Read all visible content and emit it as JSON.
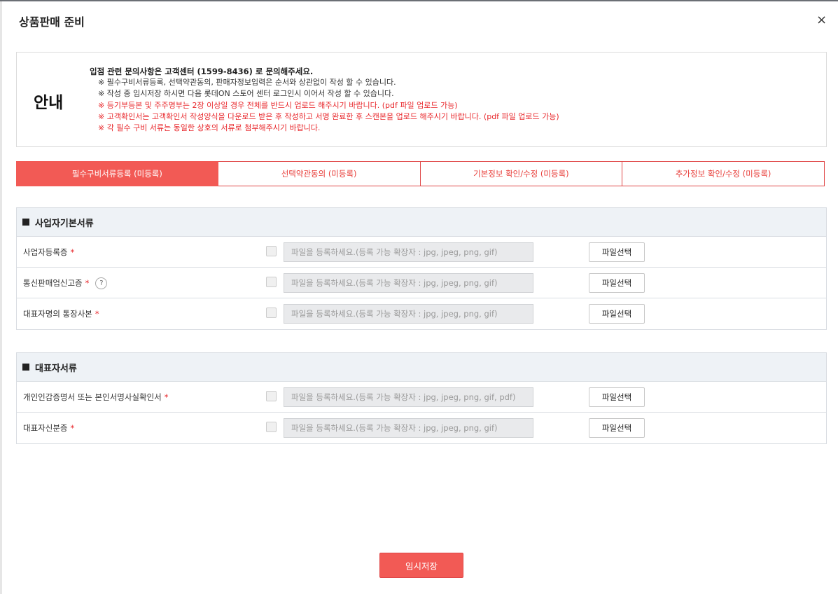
{
  "modal": {
    "title": "상품판매 준비",
    "close_label": "×"
  },
  "notice": {
    "label": "안내",
    "heading": "입점 관련 문의사항은 고객센터 (1599-8436) 로 문의해주세요.",
    "lines": [
      {
        "text": "※ 필수구비서류등록, 선택약관동의, 판매자정보입력은 순서와 상관없이 작성 할 수 있습니다.",
        "red": false
      },
      {
        "text": "※ 작성 중 임시저장 하시면 다음 롯데ON 스토어 센터 로그인시 이어서 작성 할 수 있습니다.",
        "red": false
      },
      {
        "text": "※ 등기부등본 및 주주명부는 2장 이상일 경우 전체를 반드시 업로드 해주시기 바랍니다. (pdf 파일 업로드 가능)",
        "red": true
      },
      {
        "text": "※ 고객확인서는 고객확인서 작성양식을 다운로드 받은 후 작성하고 서명 완료한 후 스캔본을 업로드 해주시기 바랍니다. (pdf 파일 업로드 가능)",
        "red": true
      },
      {
        "text": "※ 각 필수 구비 서류는 동일한 상호의 서류로 첨부해주시기 바랍니다.",
        "red": true
      }
    ]
  },
  "tabs": [
    {
      "label": "필수구비서류등록 (미등록)"
    },
    {
      "label": "선택약관동의 (미등록)"
    },
    {
      "label": "기본정보 확인/수정 (미등록)"
    },
    {
      "label": "추가정보 확인/수정 (미등록)"
    }
  ],
  "sections": [
    {
      "title": "사업자기본서류",
      "rows": [
        {
          "label": "사업자등록증",
          "required": "*",
          "placeholder": "파일을 등록하세요.(등록 가능 확장자 : jpg, jpeg, png, gif)",
          "button": "파일선택"
        },
        {
          "label": "통신판매업신고증",
          "required": "*",
          "help": "?",
          "placeholder": "파일을 등록하세요.(등록 가능 확장자 : jpg, jpeg, png, gif)",
          "button": "파일선택"
        },
        {
          "label": "대표자명의 통장사본",
          "required": "*",
          "placeholder": "파일을 등록하세요.(등록 가능 확장자 : jpg, jpeg, png, gif)",
          "button": "파일선택"
        }
      ]
    },
    {
      "title": "대표자서류",
      "rows": [
        {
          "label": "개인인감증명서 또는 본인서명사실확인서",
          "required": "*",
          "placeholder": "파일을 등록하세요.(등록 가능 확장자 : jpg, jpeg, png, gif, pdf)",
          "button": "파일선택"
        },
        {
          "label": "대표자신분증",
          "required": "*",
          "placeholder": "파일을 등록하세요.(등록 가능 확장자 : jpg, jpeg, png, gif)",
          "button": "파일선택"
        }
      ]
    }
  ],
  "footer": {
    "save_label": "임시저장"
  },
  "colors": {
    "accent": "#f25a55",
    "required": "#e8262a",
    "section_header_bg": "#eef2f6"
  }
}
